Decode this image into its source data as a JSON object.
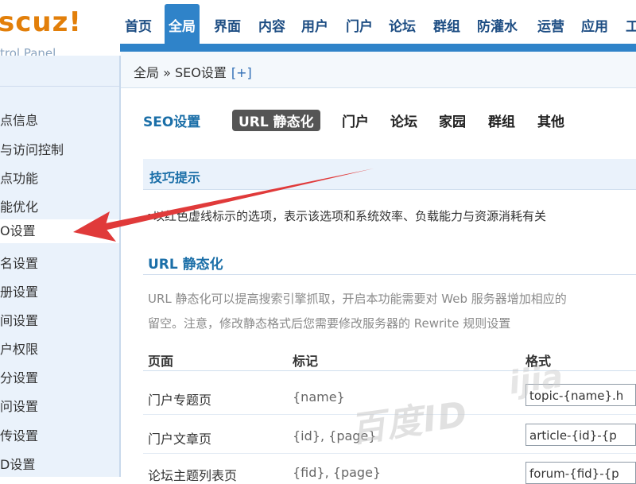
{
  "logo": {
    "brand": "scuz!",
    "subtitle": "trol Panel"
  },
  "topnav": [
    "首页",
    "全局",
    "界面",
    "内容",
    "用户",
    "门户",
    "论坛",
    "群组",
    "防灌水",
    "运营",
    "应用",
    "工"
  ],
  "breadcrumb": {
    "path": "全局 » SEO设置",
    "expand": "[+]"
  },
  "sidebar": {
    "items": [
      "点信息",
      "与访问控制",
      "点功能",
      "能优化",
      "O设置",
      "名设置",
      "册设置",
      "间设置",
      "户权限",
      "分设置",
      "问设置",
      "传设置",
      "D设置"
    ],
    "current_index": 4
  },
  "subtabs": {
    "title": "SEO设置",
    "items": [
      "URL 静态化",
      "门户",
      "论坛",
      "家园",
      "群组",
      "其他"
    ],
    "active_index": 0
  },
  "tips": {
    "title": "技巧提示",
    "text": "以红色虚线标示的选项，表示该选项和系统效率、负载能力与资源消耗有关"
  },
  "section": {
    "title": "URL 静态化",
    "desc_line1": "URL 静态化可以提高搜索引擎抓取，开启本功能需要对 Web 服务器增加相应的",
    "desc_line2": "留空。注意，修改静态格式后您需要修改服务器的 Rewrite 规则设置"
  },
  "table": {
    "headers": [
      "页面",
      "标记",
      "格式"
    ],
    "rows": [
      {
        "page": "门户专题页",
        "mark": "{name}",
        "format": "topic-{name}.h"
      },
      {
        "page": "门户文章页",
        "mark": "{id}, {page}",
        "format": "article-{id}-{p"
      },
      {
        "page": "论坛主题列表页",
        "mark": "{fid}, {page}",
        "format": "forum-{fid}-{p"
      }
    ]
  },
  "watermark": {
    "text1": "百度ID",
    "text2": "ijia"
  },
  "colors": {
    "header_blue": "#2f83c9",
    "nav_text": "#1d4d83",
    "logo_orange": "#e27f0a",
    "arrow_red": "#e03a3a"
  }
}
